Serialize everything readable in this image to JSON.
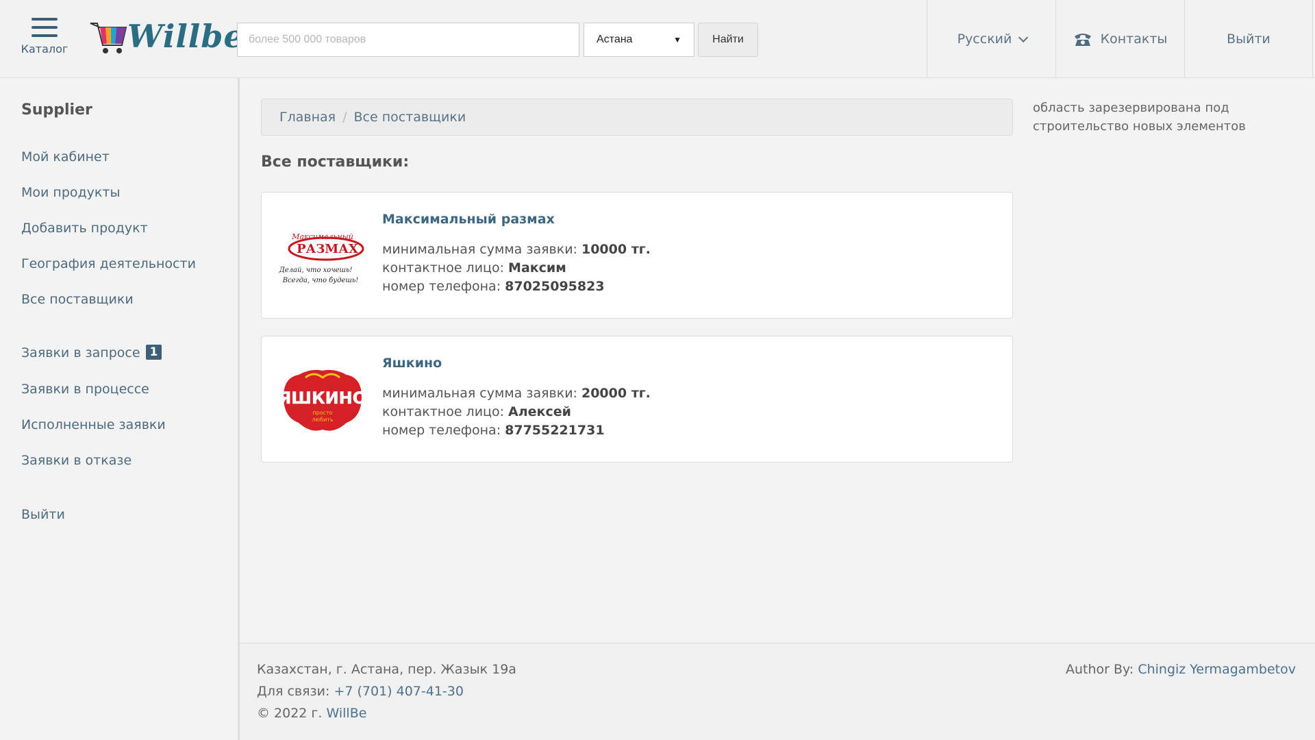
{
  "header": {
    "catalog_label": "Каталог",
    "logo_text": "Willbe",
    "search_placeholder": "более 500 000 товаров",
    "city": "Астана",
    "find_label": "Найти",
    "language": "Русский",
    "contacts": "Контакты",
    "logout": "Выйти"
  },
  "sidebar": {
    "title": "Supplier",
    "items": [
      {
        "label": "Мой кабинет"
      },
      {
        "label": "Мои продукты"
      },
      {
        "label": "Добавить продукт"
      },
      {
        "label": "География деятельности"
      },
      {
        "label": "Все поставщики"
      },
      {
        "label": "Заявки в запросе",
        "badge": "1"
      },
      {
        "label": "Заявки в процессе"
      },
      {
        "label": "Исполненные заявки"
      },
      {
        "label": "Заявки в отказе"
      },
      {
        "label": "Выйти"
      }
    ]
  },
  "breadcrumb": {
    "home": "Главная",
    "separator": "/",
    "current": "Все поставщики"
  },
  "reserved_text": "область зарезервирована под строительство новых элементов",
  "page_title": "Все поставщики:",
  "labels": {
    "min_sum": "минимальная сумма заявки: ",
    "contact": "контактное лицо: ",
    "phone": "номер телефона: "
  },
  "suppliers": [
    {
      "name": "Максимальный размах",
      "min_sum": "10000 тг.",
      "contact": "Максим",
      "phone": "87025095823",
      "logo_text": "РАЗМАХ",
      "logo_top": "Максимальный",
      "logo_caption_1": "Делай, что хочешь!",
      "logo_caption_2": "Всегда, что будешь!"
    },
    {
      "name": "Яшкино",
      "min_sum": "20000 тг.",
      "contact": "Алексей",
      "phone": "87755221731",
      "logo_text": "ЯШКИНО",
      "logo_caption_1": "просто",
      "logo_caption_2": "любить"
    }
  ],
  "footer": {
    "address": "Казахстан, г. Астана, пер. Жазык 19а",
    "contact_prefix": "Для связи: ",
    "contact_phone": "+7 (701) 407-41-30",
    "copyright_prefix": "© 2022 г. ",
    "copyright_link": "WillBe",
    "author_prefix": "Author By: ",
    "author_name": "Chingiz Yermagambetov"
  },
  "colors": {
    "accent": "#3d6680",
    "badge": "#3e5f75",
    "logo_red": "#d52028"
  }
}
